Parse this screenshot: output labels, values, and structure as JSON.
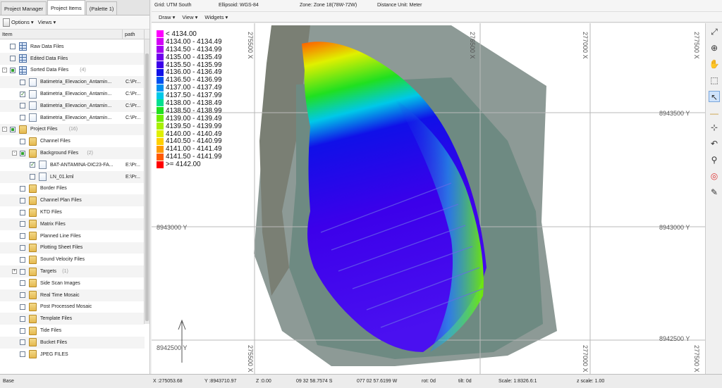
{
  "tabs": [
    "Project Manager",
    "Project Items",
    "(Palette 1)"
  ],
  "left_toolbar": {
    "options": "Options",
    "view": "Views"
  },
  "columns": {
    "item": "Item",
    "path": "path"
  },
  "tree": [
    {
      "indent": 0,
      "expander": "",
      "check": "off",
      "icon": "grid",
      "label": "Raw Data Files",
      "path": ""
    },
    {
      "indent": 0,
      "expander": "",
      "check": "off",
      "icon": "grid",
      "label": "Edited Data Files",
      "path": ""
    },
    {
      "indent": 0,
      "expander": "-",
      "check": "part",
      "icon": "grid",
      "label": "Sorted Data Files",
      "count": "(4)",
      "path": ""
    },
    {
      "indent": 1,
      "expander": "",
      "check": "off",
      "icon": "doc",
      "label": "Batimetria_Elevacion_Antamin...",
      "path": "C:\\Pr..."
    },
    {
      "indent": 1,
      "expander": "",
      "check": "on",
      "icon": "doc",
      "label": "Batimetria_Elevacion_Antamin...",
      "path": "C:\\Pr..."
    },
    {
      "indent": 1,
      "expander": "",
      "check": "off",
      "icon": "doc",
      "label": "Batimetria_Elevacion_Antamin...",
      "path": "C:\\Pr..."
    },
    {
      "indent": 1,
      "expander": "",
      "check": "off",
      "icon": "doc",
      "label": "Batimetria_Elevacion_Antamin...",
      "path": "C:\\Pr..."
    },
    {
      "indent": 0,
      "expander": "-",
      "check": "part",
      "icon": "folder",
      "label": "Project Files",
      "count": "(16)",
      "path": ""
    },
    {
      "indent": 1,
      "expander": "",
      "check": "off",
      "icon": "folder",
      "label": "Channel Files",
      "path": ""
    },
    {
      "indent": 1,
      "expander": "-",
      "check": "part",
      "icon": "folder",
      "label": "Background Files",
      "count": "(2)",
      "path": ""
    },
    {
      "indent": 2,
      "expander": "",
      "check": "on",
      "icon": "doc",
      "label": "BAT-ANTAMINA-DIC23-FA...",
      "path": "E:\\Pr..."
    },
    {
      "indent": 2,
      "expander": "",
      "check": "off",
      "icon": "doc",
      "label": "LN_01.kml",
      "path": "E:\\Pr..."
    },
    {
      "indent": 1,
      "expander": "",
      "check": "off",
      "icon": "folder",
      "label": "Border Files",
      "path": ""
    },
    {
      "indent": 1,
      "expander": "",
      "check": "off",
      "icon": "folder",
      "label": "Channel Plan Files",
      "path": ""
    },
    {
      "indent": 1,
      "expander": "",
      "check": "off",
      "icon": "folder",
      "label": "KTD Files",
      "path": ""
    },
    {
      "indent": 1,
      "expander": "",
      "check": "off",
      "icon": "folder",
      "label": "Matrix Files",
      "path": ""
    },
    {
      "indent": 1,
      "expander": "",
      "check": "off",
      "icon": "folder",
      "label": "Planned Line Files",
      "path": ""
    },
    {
      "indent": 1,
      "expander": "",
      "check": "off",
      "icon": "folder",
      "label": "Plotting Sheet Files",
      "path": ""
    },
    {
      "indent": 1,
      "expander": "",
      "check": "off",
      "icon": "folder",
      "label": "Sound Velocity Files",
      "path": ""
    },
    {
      "indent": 1,
      "expander": "+",
      "check": "off",
      "icon": "folder",
      "label": "Targets",
      "count": "(1)",
      "path": ""
    },
    {
      "indent": 1,
      "expander": "",
      "check": "off",
      "icon": "folder",
      "label": "Side Scan Images",
      "path": ""
    },
    {
      "indent": 1,
      "expander": "",
      "check": "off",
      "icon": "folder",
      "label": "Real Time Mosaic",
      "path": ""
    },
    {
      "indent": 1,
      "expander": "",
      "check": "off",
      "icon": "folder",
      "label": "Post Processed Mosaic",
      "path": ""
    },
    {
      "indent": 1,
      "expander": "",
      "check": "off",
      "icon": "folder",
      "label": "Template Files",
      "path": ""
    },
    {
      "indent": 1,
      "expander": "",
      "check": "off",
      "icon": "folder",
      "label": "Tide Files",
      "path": ""
    },
    {
      "indent": 1,
      "expander": "",
      "check": "off",
      "icon": "folder",
      "label": "Bucket Files",
      "path": ""
    },
    {
      "indent": 1,
      "expander": "",
      "check": "off",
      "icon": "folder",
      "label": "JPEG FILES",
      "path": ""
    }
  ],
  "map_header": {
    "grid": "Grid: UTM South",
    "ellipsoid": "Ellipsoid: WGS-84",
    "zone": "Zone: Zone 18(78W-72W)",
    "distance": "Distance Unit: Meter"
  },
  "map_tools": [
    "Draw",
    "View",
    "Widgets"
  ],
  "legend": [
    {
      "label": "< 4134.00",
      "color": "#ff00ff"
    },
    {
      "label": "4134.00 - 4134.49",
      "color": "#d400f7"
    },
    {
      "label": "4134.50 - 4134.99",
      "color": "#a500f2"
    },
    {
      "label": "4135.00 - 4135.49",
      "color": "#6e00ec"
    },
    {
      "label": "4135.50 - 4135.99",
      "color": "#3c00ea"
    },
    {
      "label": "4136.00 - 4136.49",
      "color": "#1010e8"
    },
    {
      "label": "4136.50 - 4136.99",
      "color": "#0050f0"
    },
    {
      "label": "4137.00 - 4137.49",
      "color": "#0090f0"
    },
    {
      "label": "4137.50 - 4137.99",
      "color": "#00c8e8"
    },
    {
      "label": "4138.00 - 4138.49",
      "color": "#00e090"
    },
    {
      "label": "4138.50 - 4138.99",
      "color": "#20e020"
    },
    {
      "label": "4139.00 - 4139.49",
      "color": "#70ee00"
    },
    {
      "label": "4139.50 - 4139.99",
      "color": "#a8f000"
    },
    {
      "label": "4140.00 - 4140.49",
      "color": "#e0f000"
    },
    {
      "label": "4140.50 - 4140.99",
      "color": "#ffd000"
    },
    {
      "label": "4141.00 - 4141.49",
      "color": "#ff9a00"
    },
    {
      "label": "4141.50 - 4141.99",
      "color": "#ff5a00"
    },
    {
      "label": ">= 4142.00",
      "color": "#ff0000"
    }
  ],
  "grid_labels": {
    "x_275500": "275500 X",
    "x_276500": "276500 X",
    "x_277000": "277000 X",
    "x_277500": "277500 X",
    "y_8943500": "8943500 Y",
    "y_8943000_left": "8943000 Y",
    "y_8943000_right": "8943000 Y",
    "y_8942500_left": "8942500 Y",
    "y_8942500_right": "8942500 Y"
  },
  "status": {
    "base": "Base",
    "x": "X :275053.68",
    "y": "Y :8943710.97",
    "z": "Z :0.00",
    "lat": "09 32 58.7574 S",
    "lon": "077 02 57.6199 W",
    "rot": "rot:    0d",
    "tilt": "tilt:    0d",
    "scale": "Scale: 1:8326.6:1",
    "zscale": "z scale: 1.00"
  }
}
